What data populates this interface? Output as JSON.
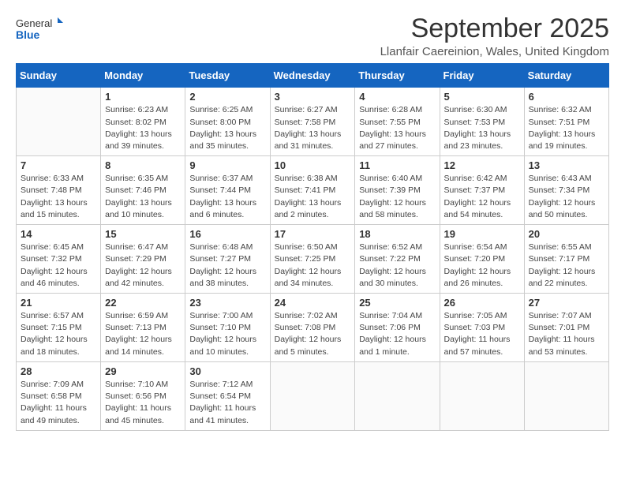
{
  "logo": {
    "general": "General",
    "blue": "Blue"
  },
  "title": "September 2025",
  "location": "Llanfair Caereinion, Wales, United Kingdom",
  "headers": [
    "Sunday",
    "Monday",
    "Tuesday",
    "Wednesday",
    "Thursday",
    "Friday",
    "Saturday"
  ],
  "weeks": [
    [
      {
        "day": "",
        "sunrise": "",
        "sunset": "",
        "daylight": ""
      },
      {
        "day": "1",
        "sunrise": "Sunrise: 6:23 AM",
        "sunset": "Sunset: 8:02 PM",
        "daylight": "Daylight: 13 hours and 39 minutes."
      },
      {
        "day": "2",
        "sunrise": "Sunrise: 6:25 AM",
        "sunset": "Sunset: 8:00 PM",
        "daylight": "Daylight: 13 hours and 35 minutes."
      },
      {
        "day": "3",
        "sunrise": "Sunrise: 6:27 AM",
        "sunset": "Sunset: 7:58 PM",
        "daylight": "Daylight: 13 hours and 31 minutes."
      },
      {
        "day": "4",
        "sunrise": "Sunrise: 6:28 AM",
        "sunset": "Sunset: 7:55 PM",
        "daylight": "Daylight: 13 hours and 27 minutes."
      },
      {
        "day": "5",
        "sunrise": "Sunrise: 6:30 AM",
        "sunset": "Sunset: 7:53 PM",
        "daylight": "Daylight: 13 hours and 23 minutes."
      },
      {
        "day": "6",
        "sunrise": "Sunrise: 6:32 AM",
        "sunset": "Sunset: 7:51 PM",
        "daylight": "Daylight: 13 hours and 19 minutes."
      }
    ],
    [
      {
        "day": "7",
        "sunrise": "Sunrise: 6:33 AM",
        "sunset": "Sunset: 7:48 PM",
        "daylight": "Daylight: 13 hours and 15 minutes."
      },
      {
        "day": "8",
        "sunrise": "Sunrise: 6:35 AM",
        "sunset": "Sunset: 7:46 PM",
        "daylight": "Daylight: 13 hours and 10 minutes."
      },
      {
        "day": "9",
        "sunrise": "Sunrise: 6:37 AM",
        "sunset": "Sunset: 7:44 PM",
        "daylight": "Daylight: 13 hours and 6 minutes."
      },
      {
        "day": "10",
        "sunrise": "Sunrise: 6:38 AM",
        "sunset": "Sunset: 7:41 PM",
        "daylight": "Daylight: 13 hours and 2 minutes."
      },
      {
        "day": "11",
        "sunrise": "Sunrise: 6:40 AM",
        "sunset": "Sunset: 7:39 PM",
        "daylight": "Daylight: 12 hours and 58 minutes."
      },
      {
        "day": "12",
        "sunrise": "Sunrise: 6:42 AM",
        "sunset": "Sunset: 7:37 PM",
        "daylight": "Daylight: 12 hours and 54 minutes."
      },
      {
        "day": "13",
        "sunrise": "Sunrise: 6:43 AM",
        "sunset": "Sunset: 7:34 PM",
        "daylight": "Daylight: 12 hours and 50 minutes."
      }
    ],
    [
      {
        "day": "14",
        "sunrise": "Sunrise: 6:45 AM",
        "sunset": "Sunset: 7:32 PM",
        "daylight": "Daylight: 12 hours and 46 minutes."
      },
      {
        "day": "15",
        "sunrise": "Sunrise: 6:47 AM",
        "sunset": "Sunset: 7:29 PM",
        "daylight": "Daylight: 12 hours and 42 minutes."
      },
      {
        "day": "16",
        "sunrise": "Sunrise: 6:48 AM",
        "sunset": "Sunset: 7:27 PM",
        "daylight": "Daylight: 12 hours and 38 minutes."
      },
      {
        "day": "17",
        "sunrise": "Sunrise: 6:50 AM",
        "sunset": "Sunset: 7:25 PM",
        "daylight": "Daylight: 12 hours and 34 minutes."
      },
      {
        "day": "18",
        "sunrise": "Sunrise: 6:52 AM",
        "sunset": "Sunset: 7:22 PM",
        "daylight": "Daylight: 12 hours and 30 minutes."
      },
      {
        "day": "19",
        "sunrise": "Sunrise: 6:54 AM",
        "sunset": "Sunset: 7:20 PM",
        "daylight": "Daylight: 12 hours and 26 minutes."
      },
      {
        "day": "20",
        "sunrise": "Sunrise: 6:55 AM",
        "sunset": "Sunset: 7:17 PM",
        "daylight": "Daylight: 12 hours and 22 minutes."
      }
    ],
    [
      {
        "day": "21",
        "sunrise": "Sunrise: 6:57 AM",
        "sunset": "Sunset: 7:15 PM",
        "daylight": "Daylight: 12 hours and 18 minutes."
      },
      {
        "day": "22",
        "sunrise": "Sunrise: 6:59 AM",
        "sunset": "Sunset: 7:13 PM",
        "daylight": "Daylight: 12 hours and 14 minutes."
      },
      {
        "day": "23",
        "sunrise": "Sunrise: 7:00 AM",
        "sunset": "Sunset: 7:10 PM",
        "daylight": "Daylight: 12 hours and 10 minutes."
      },
      {
        "day": "24",
        "sunrise": "Sunrise: 7:02 AM",
        "sunset": "Sunset: 7:08 PM",
        "daylight": "Daylight: 12 hours and 5 minutes."
      },
      {
        "day": "25",
        "sunrise": "Sunrise: 7:04 AM",
        "sunset": "Sunset: 7:06 PM",
        "daylight": "Daylight: 12 hours and 1 minute."
      },
      {
        "day": "26",
        "sunrise": "Sunrise: 7:05 AM",
        "sunset": "Sunset: 7:03 PM",
        "daylight": "Daylight: 11 hours and 57 minutes."
      },
      {
        "day": "27",
        "sunrise": "Sunrise: 7:07 AM",
        "sunset": "Sunset: 7:01 PM",
        "daylight": "Daylight: 11 hours and 53 minutes."
      }
    ],
    [
      {
        "day": "28",
        "sunrise": "Sunrise: 7:09 AM",
        "sunset": "Sunset: 6:58 PM",
        "daylight": "Daylight: 11 hours and 49 minutes."
      },
      {
        "day": "29",
        "sunrise": "Sunrise: 7:10 AM",
        "sunset": "Sunset: 6:56 PM",
        "daylight": "Daylight: 11 hours and 45 minutes."
      },
      {
        "day": "30",
        "sunrise": "Sunrise: 7:12 AM",
        "sunset": "Sunset: 6:54 PM",
        "daylight": "Daylight: 11 hours and 41 minutes."
      },
      {
        "day": "",
        "sunrise": "",
        "sunset": "",
        "daylight": ""
      },
      {
        "day": "",
        "sunrise": "",
        "sunset": "",
        "daylight": ""
      },
      {
        "day": "",
        "sunrise": "",
        "sunset": "",
        "daylight": ""
      },
      {
        "day": "",
        "sunrise": "",
        "sunset": "",
        "daylight": ""
      }
    ]
  ]
}
